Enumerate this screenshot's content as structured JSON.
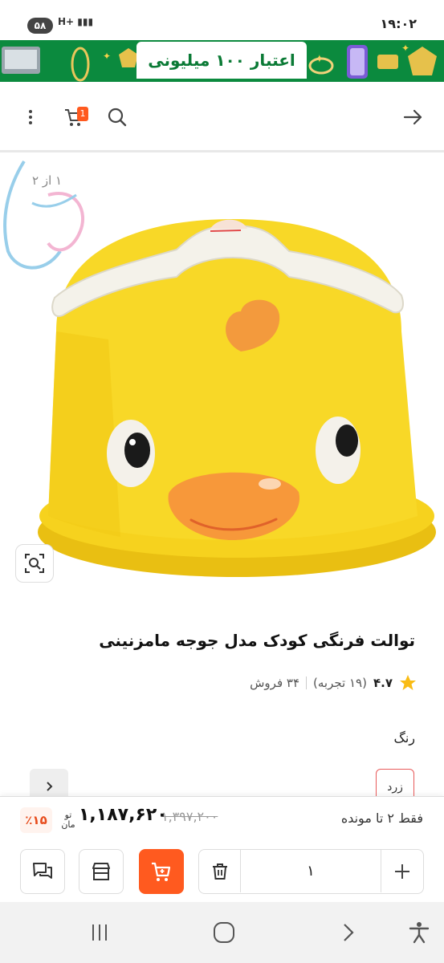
{
  "status_bar": {
    "time": "۱۹:۰۲",
    "battery": "۵۸",
    "network": "H+"
  },
  "banner": {
    "text": "اعتبار ۱۰۰ میلیونی"
  },
  "product": {
    "image_counter": "۱ از ۲",
    "title": "توالت فرنگی کودک مدل جوجه مامزنینی",
    "rating": "۴.۷",
    "reviews": "(۱۹ تجربه)",
    "sales": "۳۴ فروش",
    "color_label": "رنگ",
    "color_option": "زرد"
  },
  "cart": {
    "badge_count": "1"
  },
  "purchase": {
    "stock_text": "فقط ۲ تا مونده",
    "price_old": "۱,۳۹۷,۲۰۰",
    "price_now": "۱,۱۸۷,۶۲۰",
    "currency_top": "تو",
    "currency_bottom": "مان",
    "discount": "٪۱۵",
    "quantity": "۱"
  },
  "colors": {
    "accent": "#ff5a1f",
    "banner_green": "#0b8a3e",
    "product_yellow": "#f6d21e"
  }
}
